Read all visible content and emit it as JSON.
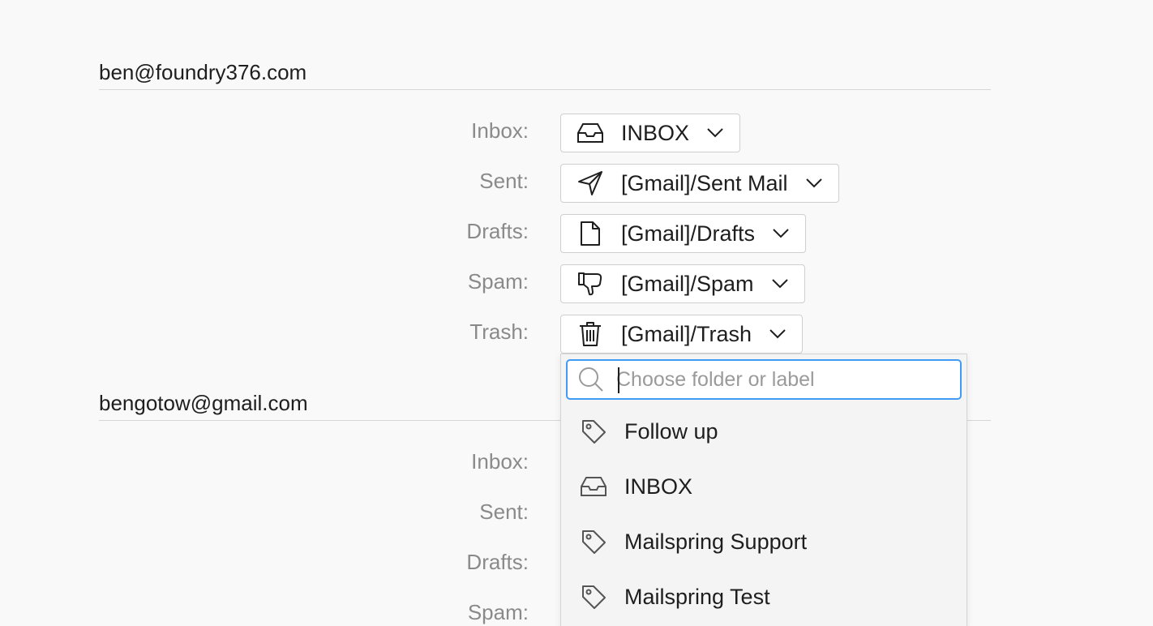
{
  "accounts": [
    {
      "email": "ben@foundry376.com",
      "rows": [
        {
          "label": "Inbox:",
          "folder": "INBOX",
          "icon": "inbox-icon"
        },
        {
          "label": "Sent:",
          "folder": "[Gmail]/Sent Mail",
          "icon": "send-icon"
        },
        {
          "label": "Drafts:",
          "folder": "[Gmail]/Drafts",
          "icon": "document-icon"
        },
        {
          "label": "Spam:",
          "folder": "[Gmail]/Spam",
          "icon": "thumbs-down-icon"
        },
        {
          "label": "Trash:",
          "folder": "[Gmail]/Trash",
          "icon": "trash-icon"
        }
      ]
    },
    {
      "email": "bengotow@gmail.com",
      "rows": [
        {
          "label": "Inbox:"
        },
        {
          "label": "Sent:"
        },
        {
          "label": "Drafts:"
        },
        {
          "label": "Spam:"
        }
      ]
    }
  ],
  "dropdown": {
    "search_placeholder": "Choose folder or label",
    "search_value": "",
    "items": [
      {
        "label": "Follow up",
        "icon": "tag-icon"
      },
      {
        "label": "INBOX",
        "icon": "inbox-icon"
      },
      {
        "label": "Mailspring Support",
        "icon": "tag-icon"
      },
      {
        "label": "Mailspring Test",
        "icon": "tag-icon"
      }
    ]
  },
  "colors": {
    "background": "#f9f9f9",
    "label_gray": "#8a8a8a",
    "focus_blue": "#3f9bf5",
    "text": "#1e1e1e"
  }
}
